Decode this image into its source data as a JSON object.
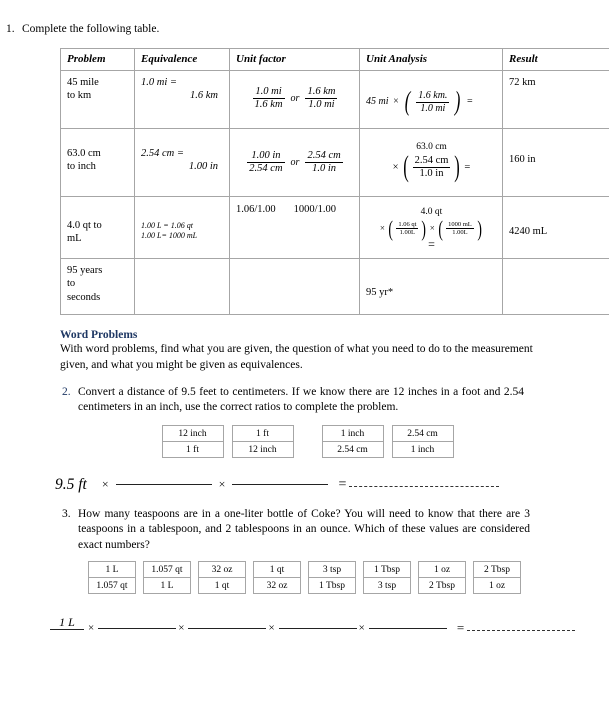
{
  "colors": {
    "heading_navy": "#1f3864",
    "table_border": "#a6a6a6",
    "text": "#000000"
  },
  "q1": {
    "number": "1.",
    "text": "Complete the following table."
  },
  "table": {
    "headers": [
      "Problem",
      "Equivalence",
      "Unit factor",
      "Unit Analysis",
      "Result"
    ],
    "rows": [
      {
        "problem_l1": "45 mile",
        "problem_l2": "to km",
        "equiv_l1": "1.0 mi =",
        "equiv_l2": "1.6 km",
        "uf_left_num": "1.0 mi",
        "uf_left_den": "1.6 km",
        "uf_or": "or",
        "uf_right_num": "1.6 km",
        "uf_right_den": "1.0 mi",
        "ua_lead": "45 mi",
        "ua_times": "×",
        "ua_num": "1.6 km.",
        "ua_den": "1.0 mi",
        "ua_eq": "=",
        "result": "72 km"
      },
      {
        "problem_l1": "63.0 cm",
        "problem_l2": "to inch",
        "equiv_l1": "2.54 cm =",
        "equiv_l2": "1.00 in",
        "uf_left_num": "1.00 in",
        "uf_left_den": "2.54 cm",
        "uf_or": "or",
        "uf_right_num": "2.54 cm",
        "uf_right_den": "1.0 in",
        "ua_top": "63.0 cm",
        "ua_times": "×",
        "ua_num": "2.54 cm",
        "ua_den": "1.0  in",
        "ua_eq": "=",
        "result": "160 in"
      },
      {
        "problem_l1": "4.0 qt to",
        "problem_l2": "mL",
        "equiv_l1": "1.00 L  = 1.06 qt",
        "equiv_l2": "1.00 L= 1000 mL",
        "uf_plain_left": "1.06/1.00",
        "uf_plain_right": "1000/1.00",
        "ua_top": "4.0 qt",
        "ua_times": "×",
        "ua_num1": "1.06 qt",
        "ua_den1": "1.00L",
        "ua_times2": "×",
        "ua_num2": "1000 mL",
        "ua_den2": "1.00L",
        "ua_eq": "=",
        "result": "4240 mL"
      },
      {
        "problem_l1": "95 years",
        "problem_l2": "to",
        "problem_l3": "seconds",
        "equiv_l1": "",
        "equiv_l2": "",
        "uf_plain_left": "",
        "uf_plain_right": "",
        "ua_plain": "95 yr*",
        "result": ""
      }
    ]
  },
  "word_problems": {
    "heading": "Word Problems",
    "body": "With word problems, find what you are given, the question of what you need to do to the measurement given, and what you might be given as equivalences."
  },
  "q2": {
    "number": "2.",
    "text": "Convert a distance of 9.5 feet to centimeters. If we know there are 12 inches in a foot and 2.54 centimeters in an inch, use the correct ratios to complete the problem.",
    "ratios": [
      {
        "top": "12 inch",
        "bottom": "1 ft"
      },
      {
        "top": "1 ft",
        "bottom": "12 inch"
      },
      {
        "top": "1 inch",
        "bottom": "2.54 cm"
      },
      {
        "top": "2.54 cm",
        "bottom": "1 inch"
      }
    ],
    "equation": {
      "lead": "9.5 ft",
      "times1": "×",
      "times2": "×",
      "equals": "="
    }
  },
  "q3": {
    "number": "3.",
    "text": "How many teaspoons are in a one-liter bottle of Coke?   You will need to know that there are 3 teaspoons in a tablespoon, and 2 tablespoons in an ounce.   Which of these values are considered exact numbers?",
    "ratios": [
      {
        "top": "1 L",
        "bottom": "1.057 qt"
      },
      {
        "top": "1.057 qt",
        "bottom": "1 L"
      },
      {
        "top": "32 oz",
        "bottom": "1 qt"
      },
      {
        "top": "1 qt",
        "bottom": "32 oz"
      },
      {
        "top": "3 tsp",
        "bottom": "1 Tbsp"
      },
      {
        "top": "1 Tbsp",
        "bottom": "3 tsp"
      },
      {
        "top": "1 oz",
        "bottom": "2 Tbsp"
      },
      {
        "top": "2 Tbsp",
        "bottom": "1 oz"
      }
    ],
    "equation": {
      "lead_num": "1 L",
      "times1": "×",
      "times2": "×",
      "times3": "×",
      "times4": "×",
      "equals": "="
    }
  }
}
